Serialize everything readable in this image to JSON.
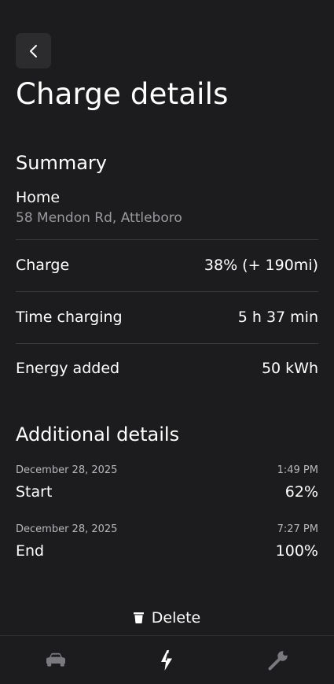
{
  "header": {
    "title": "Charge details"
  },
  "summary": {
    "title": "Summary",
    "location_name": "Home",
    "location_address": "58 Mendon Rd, Attleboro",
    "rows": [
      {
        "label": "Charge",
        "value": "38% (+ 190mi)"
      },
      {
        "label": "Time charging",
        "value": "5 h 37 min"
      },
      {
        "label": "Energy added",
        "value": "50 kWh"
      }
    ]
  },
  "additional": {
    "title": "Additional details",
    "entries": [
      {
        "date": "December 28, 2025",
        "time": "1:49 PM",
        "label": "Start",
        "value": "62%"
      },
      {
        "date": "December 28, 2025",
        "time": "7:27 PM",
        "label": "End",
        "value": "100%"
      }
    ]
  },
  "actions": {
    "delete_label": "Delete"
  },
  "tabbar": {
    "items": [
      {
        "icon": "car-icon",
        "active": false
      },
      {
        "icon": "bolt-icon",
        "active": true
      },
      {
        "icon": "wrench-icon",
        "active": false
      }
    ]
  },
  "colors": {
    "background": "#1c1c1e",
    "secondary_text": "#9a9a9e",
    "divider": "#3a3a3c",
    "inactive_icon": "#7a7a7e",
    "active_icon": "#ffffff"
  }
}
